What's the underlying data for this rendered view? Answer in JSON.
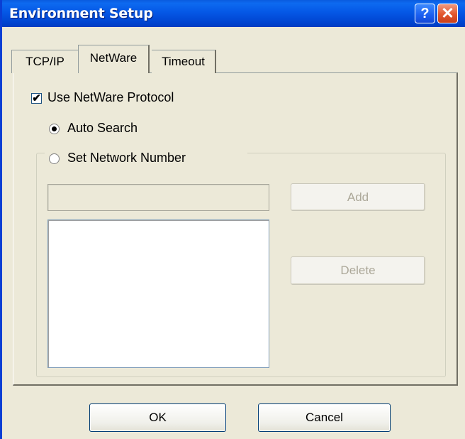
{
  "window": {
    "title": "Environment Setup",
    "help_label": "?",
    "close_label": "✕"
  },
  "tabs": [
    {
      "label": "TCP/IP",
      "selected": false
    },
    {
      "label": "NetWare",
      "selected": true
    },
    {
      "label": "Timeout",
      "selected": false
    }
  ],
  "netware": {
    "use_protocol_label": "Use NetWare Protocol",
    "use_protocol_checked": true,
    "auto_search_label": "Auto Search",
    "auto_search_selected": true,
    "set_network_label": "Set Network Number",
    "set_network_selected": false,
    "network_number_value": "",
    "network_list": [],
    "add_label": "Add",
    "delete_label": "Delete"
  },
  "footer": {
    "ok_label": "OK",
    "cancel_label": "Cancel"
  },
  "colors": {
    "titlebar": "#0558e6",
    "dialog_face": "#ece9d8",
    "close_button": "#e2562c",
    "disabled_text": "#aca899"
  },
  "icons": {
    "help": "help-icon",
    "close": "close-icon",
    "check": "checkmark-icon"
  }
}
